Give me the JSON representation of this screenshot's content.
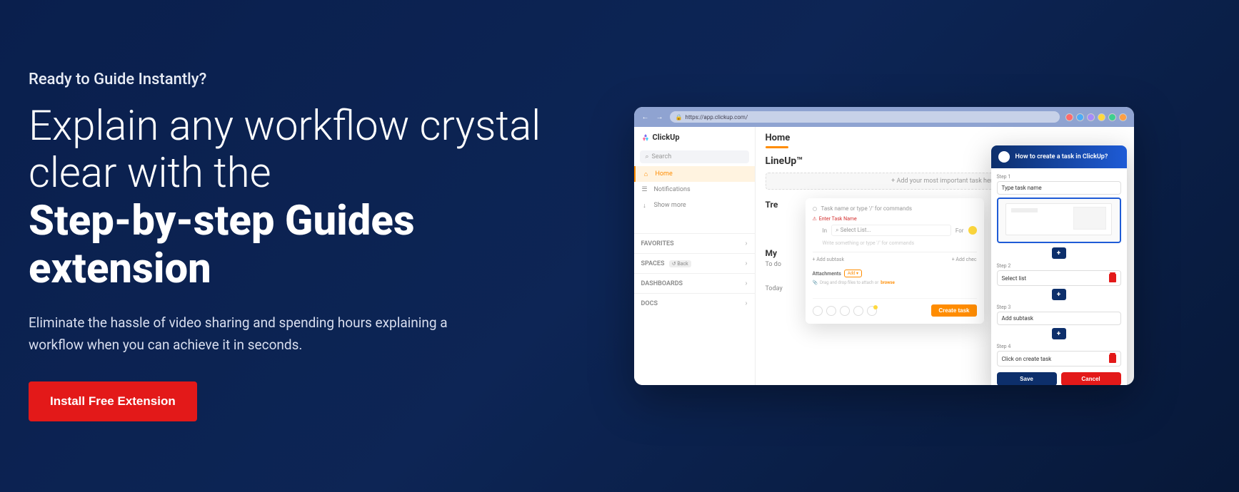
{
  "hero": {
    "eyebrow": "Ready to Guide Instantly?",
    "headline_light": "Explain any workflow crystal clear with the",
    "headline_bold": "Step-by-step Guides extension",
    "subtext": "Eliminate the hassle of video sharing and spending hours explaining a workflow when you can achieve it in seconds.",
    "cta": "Install Free Extension"
  },
  "browser": {
    "url": "https://app.clickup.com/"
  },
  "sidebar": {
    "logo": "ClickUp",
    "search_placeholder": "Search",
    "nav": {
      "home": "Home",
      "notifications": "Notifications",
      "show_more": "Show more"
    },
    "sections": {
      "favorites": "FAVORITES",
      "spaces": "SPACES",
      "spaces_badge": "Back",
      "dashboards": "DASHBOARDS",
      "docs": "DOCS"
    }
  },
  "main": {
    "title": "Home",
    "lineup": "LineUp™",
    "add_task": "+ Add your most important task here.",
    "trending": "Tre",
    "my_work": "My",
    "todo": "To do",
    "today": "Today"
  },
  "task_modal": {
    "name_prompt": "Task name or type '/' for commands",
    "enter_name": "Enter Task Name",
    "in_label": "In",
    "select_list": "Select List...",
    "for_label": "For",
    "placeholder": "Write something or type '/' for commands",
    "add_subtask": "+ Add subtask",
    "add_checklist": "+ Add chec",
    "attachments": "Attachments",
    "attach_badge": "Add ▾",
    "drag_hint": "Drag and drop files to attach or",
    "drag_hint_b": "browse",
    "create": "Create task"
  },
  "guide": {
    "title": "How to create a task in ClickUp?",
    "steps": [
      {
        "label": "Step 1",
        "text": "Type task name"
      },
      {
        "label": "Step 2",
        "text": "Select list"
      },
      {
        "label": "Step 3",
        "text": "Add subtask"
      },
      {
        "label": "Step 4",
        "text": "Click on create task"
      }
    ],
    "save": "Save",
    "cancel": "Cancel"
  }
}
